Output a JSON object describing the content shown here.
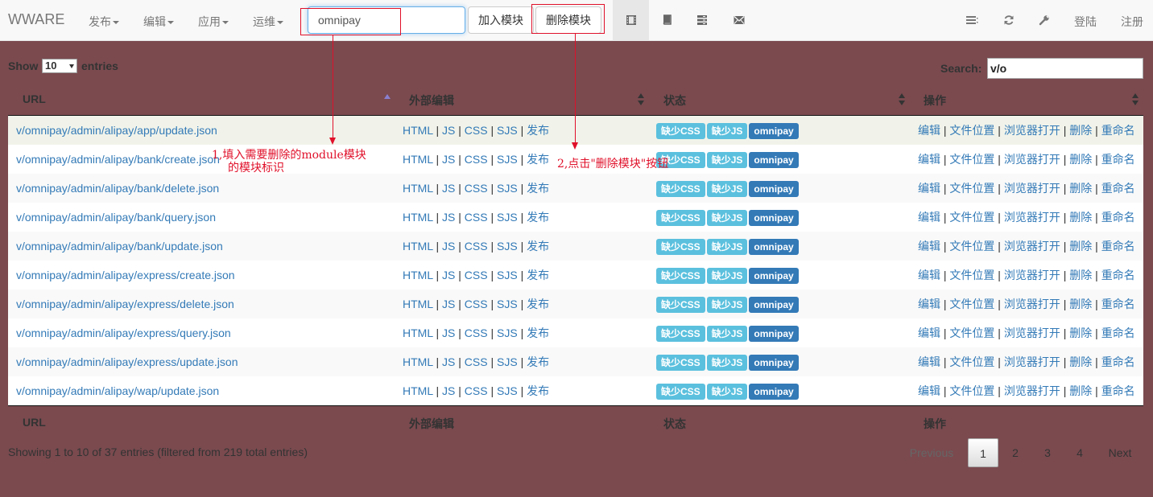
{
  "navbar": {
    "brand": "WWARE",
    "menus": [
      "发布",
      "编辑",
      "应用",
      "运维"
    ],
    "module_input_value": "omnipay",
    "add_module_label": "加入模块",
    "delete_module_label": "删除模块",
    "icons": [
      "film-icon",
      "book-icon",
      "tasks-icon",
      "envelope-icon"
    ],
    "right_icons": [
      "list-icon",
      "refresh-icon",
      "wrench-icon"
    ],
    "login_label": "登陆",
    "register_label": "注册"
  },
  "annotations": {
    "step1_line1": "1,填入需要删除的module模块",
    "step1_line2": "的模块标识",
    "step2": "2,点击\"删除模块\"按钮",
    "color": "#e0102a"
  },
  "table_controls": {
    "show_label": "Show",
    "page_length": "10",
    "entries_label": "entries",
    "search_label": "Search:",
    "search_value": "v/o"
  },
  "columns": [
    "URL",
    "外部编辑",
    "状态",
    "操作"
  ],
  "edit_links": [
    "HTML",
    "JS",
    "CSS",
    "SJS",
    "发布"
  ],
  "status_badges": [
    "缺少CSS",
    "缺少JS",
    "omnipay"
  ],
  "actions": [
    "编辑",
    "文件位置",
    "浏览器打开",
    "删除",
    "重命名"
  ],
  "rows": [
    {
      "url": "v/omnipay/admin/alipay/app/update.json"
    },
    {
      "url": "v/omnipay/admin/alipay/bank/create.json"
    },
    {
      "url": "v/omnipay/admin/alipay/bank/delete.json"
    },
    {
      "url": "v/omnipay/admin/alipay/bank/query.json"
    },
    {
      "url": "v/omnipay/admin/alipay/bank/update.json"
    },
    {
      "url": "v/omnipay/admin/alipay/express/create.json"
    },
    {
      "url": "v/omnipay/admin/alipay/express/delete.json"
    },
    {
      "url": "v/omnipay/admin/alipay/express/query.json"
    },
    {
      "url": "v/omnipay/admin/alipay/express/update.json"
    },
    {
      "url": "v/omnipay/admin/alipay/wap/update.json"
    }
  ],
  "info_text": "Showing 1 to 10 of 37 entries (filtered from 219 total entries)",
  "pagination": {
    "previous": "Previous",
    "pages": [
      "1",
      "2",
      "3",
      "4"
    ],
    "next": "Next",
    "current": "1"
  },
  "colors": {
    "page_background": "#7a4a4f",
    "link": "#337ab7",
    "badge_info": "#5bc0de",
    "badge_primary": "#337ab7"
  }
}
